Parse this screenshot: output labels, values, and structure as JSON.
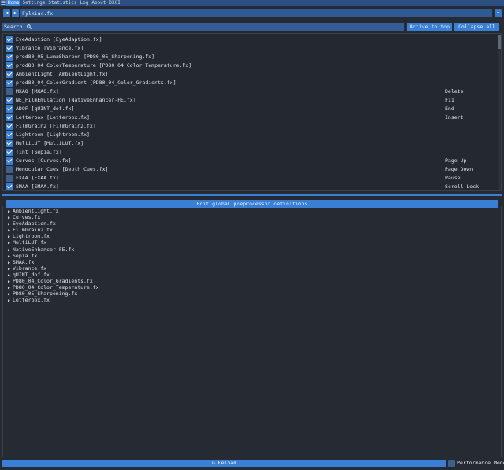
{
  "menu": {
    "tabs": [
      {
        "label": "Home",
        "active": true
      },
      {
        "label": "Settings",
        "active": false
      },
      {
        "label": "Statistics",
        "active": false
      },
      {
        "label": "Log",
        "active": false
      },
      {
        "label": "About",
        "active": false
      },
      {
        "label": "DXGI",
        "active": false
      }
    ]
  },
  "preset": {
    "prev_icon": "◀",
    "next_icon": "▶",
    "name": "Fylkiar.fx",
    "add_icon": "+"
  },
  "search": {
    "label": "Search",
    "icon": "search-icon"
  },
  "buttons": {
    "active_to_top": "Active to top",
    "collapse_all": "Collapse all",
    "edit_preprocessor": "Edit global preprocessor definitions",
    "reload": "Reload",
    "reload_icon": "↻",
    "performance_mode": "Performance Mode"
  },
  "effects": [
    {
      "label": "EyeAdaption [EyeAdaption.fx]",
      "enabled": true,
      "key": ""
    },
    {
      "label": "Vibrance [Vibrance.fx]",
      "enabled": true,
      "key": ""
    },
    {
      "label": "prod80_05_LumaSharpen [PD80_05_Sharpening.fx]",
      "enabled": true,
      "key": ""
    },
    {
      "label": "prod80_04_ColorTemperature [PD80_04_Color_Temperature.fx]",
      "enabled": true,
      "key": ""
    },
    {
      "label": "AmbientLight [AmbientLight.fx]",
      "enabled": true,
      "key": ""
    },
    {
      "label": "prod80_04_ColorGradient [PD80_04_Color_Gradients.fx]",
      "enabled": true,
      "key": ""
    },
    {
      "label": "MXAO [MXAO.fx]",
      "enabled": false,
      "key": "Delete"
    },
    {
      "label": "NE_FilmEmulation [NativeEnhancer-FE.fx]",
      "enabled": true,
      "key": "F11"
    },
    {
      "label": "ADOF [qUINT_dof.fx]",
      "enabled": true,
      "key": "End"
    },
    {
      "label": "Letterbox [Letterbox.fx]",
      "enabled": true,
      "key": "Insert"
    },
    {
      "label": "FilmGrain2 [FilmGrain2.fx]",
      "enabled": true,
      "key": ""
    },
    {
      "label": "Lightroom [Lightroom.fx]",
      "enabled": true,
      "key": ""
    },
    {
      "label": "MultiLUT [MultiLUT.fx]",
      "enabled": true,
      "key": ""
    },
    {
      "label": "Tint [Sepia.fx]",
      "enabled": true,
      "key": ""
    },
    {
      "label": "Curves [Curves.fx]",
      "enabled": true,
      "key": "Page Up"
    },
    {
      "label": "Monocular_Cues [Depth_Cues.fx]",
      "enabled": false,
      "key": "Page Down"
    },
    {
      "label": "FXAA [FXAA.fx]",
      "enabled": false,
      "key": "Pause"
    },
    {
      "label": "SMAA [SMAA.fx]",
      "enabled": true,
      "key": "Scroll Lock"
    }
  ],
  "preprocessor_files": [
    "AmbientLight.fx",
    "Curves.fx",
    "EyeAdaption.fx",
    "FilmGrain2.fx",
    "Lightroom.fx",
    "MultiLUT.fx",
    "NativeEnhancer-FE.fx",
    "Sepia.fx",
    "SMAA.fx",
    "Vibrance.fx",
    "qUINT_dof.fx",
    "PD80_04_Color_Gradients.fx",
    "PD80_04_Color_Temperature.fx",
    "PD80_05_Sharpening.fx",
    "Letterbox.fx"
  ],
  "performance_mode_enabled": false,
  "colors": {
    "accent": "#3a7fd6",
    "background": "#252a33",
    "menubar": "#2b4d7f"
  }
}
